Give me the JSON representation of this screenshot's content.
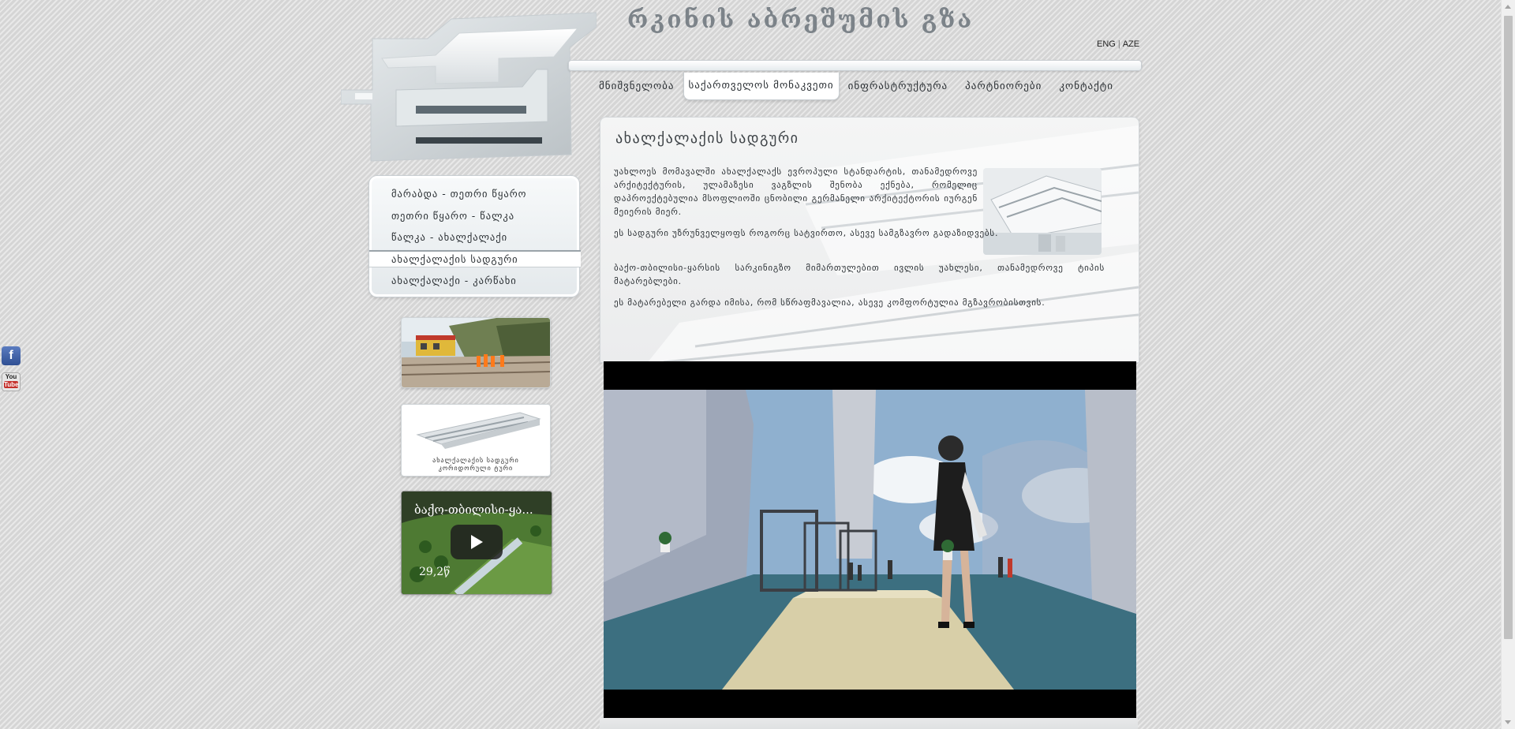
{
  "site": {
    "title": "რკინის აბრეშუმის გზა",
    "lang_en": "ENG",
    "lang_sep": "|",
    "lang_az": "AZE"
  },
  "nav": {
    "items": [
      {
        "label": "მნიშვნელობა"
      },
      {
        "label": "საქართველოს მონაკვეთი",
        "active": true
      },
      {
        "label": "ინფრასტრუქტურა"
      },
      {
        "label": "პარტნიორები"
      },
      {
        "label": "კონტაქტი"
      }
    ]
  },
  "sidebar": {
    "items": [
      {
        "label": "მარაბდა - თეთრი წყარო"
      },
      {
        "label": "თეთრი წყარო - წალკა"
      },
      {
        "label": "წალკა - ახალქალაქი"
      },
      {
        "label": "ახალქალაქის სადგური",
        "active": true
      },
      {
        "label": "ახალქალაქი - კარწახი"
      }
    ],
    "thumb2_caption_1": "ახალქალაქის სადგური",
    "thumb2_caption_2": "კორიდორული ტური",
    "video_title": "ბაქო-თბილისი-ყა...",
    "video_date": "29,2წ"
  },
  "content": {
    "title": "ახალქალაქის სადგური",
    "paragraph_1": "უახლოეს მომავალში ახალქალაქს ევროპული სტანდარტის, თანამედროვე არქიტექტურის, ულამაზესი ვაგზლის შენობა ექნება, რომელიც დაპროექტებულია მსოფლიოში ცნობილი გერმანელი არქიტექტორის იურგენ მეიერის მიერ.",
    "paragraph_2": "ეს სადგური უზრუნველყოფს როგორც სატვირთო, ასევე სამგზავრო გადაზიდვებს.",
    "paragraph_3": "ბაქო-თბილისი-ყარსის სარკინიგზო მიმართულებით ივლის უახლესი, თანამედროვე ტიპის მატარებლები.",
    "paragraph_4": "ეს მატარებელი გარდა იმისა, რომ სწრაფმავალია, ასევე კომფორტულია მგზავრობისთვის."
  },
  "social": {
    "facebook": "f",
    "youtube_top": "You",
    "youtube_bottom": "Tube"
  },
  "colors": {
    "background": "#dcdcdc",
    "title_text": "#7c8389",
    "panel": "#f4f5f5"
  }
}
